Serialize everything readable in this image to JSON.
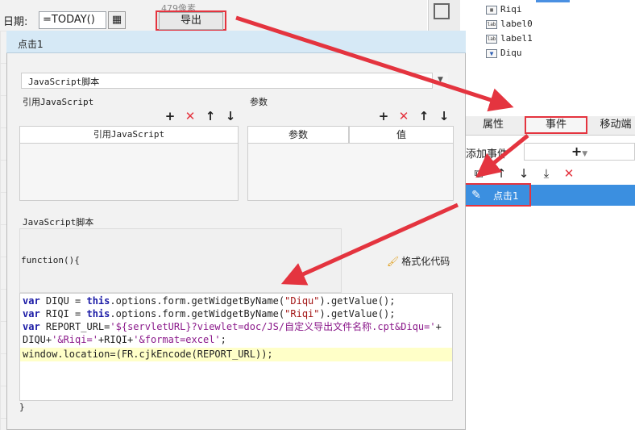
{
  "designer": {
    "date_label": "日期:",
    "date_value": "=TODAY()",
    "pixel_hint": "479像素",
    "export_button": "导出"
  },
  "widget_tree": {
    "items": [
      {
        "icon": "calendar-icon",
        "label": "Riqi"
      },
      {
        "icon": "label-icon",
        "label": "label0"
      },
      {
        "icon": "label-icon",
        "label": "label1"
      },
      {
        "icon": "dropdown-icon",
        "label": "Diqu"
      }
    ]
  },
  "props_panel": {
    "tabs": [
      "属性",
      "事件",
      "移动端"
    ],
    "add_event_label": "添加事件",
    "add_event_symbol": "+",
    "event_item": "点击1"
  },
  "dialog": {
    "title": "点击1",
    "language": "JavaScript脚本",
    "ref_label": "引用JavaScript",
    "params_label": "参数",
    "ref_column": "引用JavaScript",
    "param_columns": [
      "参数",
      "值"
    ],
    "script_label": "JavaScript脚本",
    "function_open": "function(){",
    "format_button": "格式化代码",
    "function_close": "}"
  },
  "code": {
    "line1": {
      "kw1": "var",
      "a": " DIQU = ",
      "kw2": "this",
      "b": ".options.form.getWidgetByName(",
      "s": "\"Diqu\"",
      "c": ").getValue();"
    },
    "line2": {
      "kw1": "var",
      "a": " RIQI = ",
      "kw2": "this",
      "b": ".options.form.getWidgetByName(",
      "s": "\"Riqi\"",
      "c": ").getValue();"
    },
    "line3": {
      "kw1": "var",
      "a": " REPORT_URL=",
      "s": "'${servletURL}?viewlet=doc/JS/自定义导出文件名称.cpt&Diqu='",
      "c": "+"
    },
    "line4": {
      "a": "DIQU+",
      "s1": "'&Riqi='",
      "b": "+RIQI+",
      "s2": "'&format=excel'",
      "c": ";"
    },
    "line5": "window.location=(FR.cjkEncode(REPORT_URL));"
  },
  "colors": {
    "annotation": "#e4343f",
    "selection": "#3b8fe0",
    "dialog_header": "#d6e9f6"
  }
}
